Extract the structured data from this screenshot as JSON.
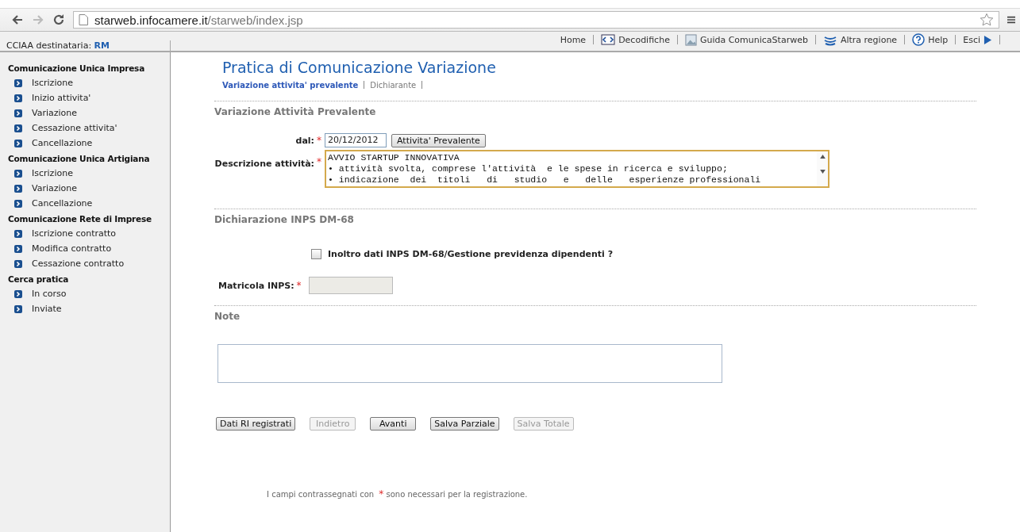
{
  "browser": {
    "url_host": "starweb.infocamere.it",
    "url_path": "/starweb/index.jsp"
  },
  "header": {
    "recipient_label": "CCIAA destinataria:",
    "recipient_value": "RM",
    "links": [
      "Home",
      "Decodifiche",
      "Guida ComunicaStarweb",
      "Altra regione",
      "Help",
      "Esci"
    ]
  },
  "sidebar": [
    {
      "title": "Comunicazione Unica Impresa",
      "items": [
        "Iscrizione",
        "Inizio attivita'",
        "Variazione",
        "Cessazione attivita'",
        "Cancellazione"
      ]
    },
    {
      "title": "Comunicazione Unica Artigiana",
      "items": [
        "Iscrizione",
        "Variazione",
        "Cancellazione"
      ]
    },
    {
      "title": "Comunicazione Rete di Imprese",
      "items": [
        "Iscrizione contratto",
        "Modifica contratto",
        "Cessazione contratto"
      ]
    },
    {
      "title": "Cerca pratica",
      "items": [
        "In corso",
        "Inviate"
      ]
    }
  ],
  "page_title": "Pratica di Comunicazione Variazione",
  "steps": [
    {
      "label": "Variazione attivita' prevalente",
      "selected": true
    },
    {
      "label": "Dichiarante",
      "selected": false
    }
  ],
  "required_mark": "*",
  "section_activity": {
    "title": "Variazione Attività Prevalente",
    "date_label": "dal:",
    "date_required": true,
    "date_value": "20/12/2012",
    "date_button": "Attivita' Prevalente",
    "description_label": "Descrizione attività:",
    "description_required": true,
    "description_lines": [
      "AVVIO STARTUP INNOVATIVA",
      "• attività svolta, comprese l'attività  e le spese in ricerca e sviluppo;",
      "• indicazione  dei  titoli   di   studio   e   delle   esperienze professionali"
    ]
  },
  "section_inps": {
    "title": "Dichiarazione INPS DM-68",
    "checkbox_label": "Inoltro dati INPS DM-68/Gestione previdenza dipendenti ?",
    "checked": false,
    "matricola_label": "Matricola INPS:",
    "matricola_required": true,
    "matricola_disabled": true
  },
  "section_note": {
    "title": "Note"
  },
  "buttons": [
    {
      "label": "Dati RI registrati",
      "disabled": false
    },
    {
      "label": "Indietro",
      "disabled": true
    },
    {
      "label": "Avanti",
      "disabled": false
    },
    {
      "label": "Salva Parziale",
      "disabled": false
    },
    {
      "label": "Salva Totale",
      "disabled": true
    }
  ],
  "footer_note_before": "I campi contrassegnati con",
  "footer_note_after": "sono necessari per la registrazione."
}
